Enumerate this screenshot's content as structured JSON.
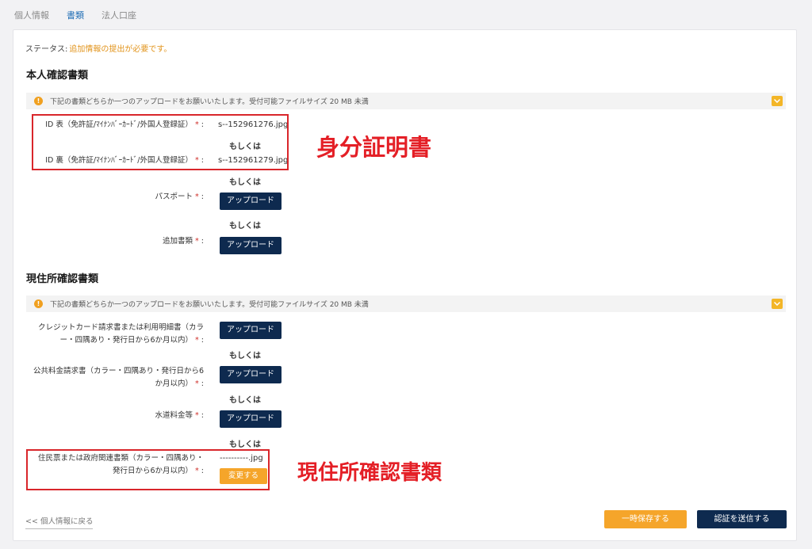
{
  "tabs": [
    "個人情報",
    "書類",
    "法人口座"
  ],
  "status": {
    "label": "ステータス:",
    "value": "追加情報の提出が必要です。"
  },
  "identity": {
    "title": "本人確認書類",
    "notice": "下記の書類どちらか一つのアップロードをお願いいたします。受付可能ファイルサイズ 20 MB 未満",
    "id_front": {
      "label": "ID 表（免許証/ﾏｲﾅﾝﾊﾞｰｶｰﾄﾞ/外国人登録証）",
      "file": "s--152961276.jpg"
    },
    "id_back": {
      "label": "ID 裏（免許証/ﾏｲﾅﾝﾊﾞｰｶｰﾄﾞ/外国人登録証）",
      "file": "s--152961279.jpg"
    },
    "passport": {
      "label": "パスポート"
    },
    "additional": {
      "label": "追加書類"
    }
  },
  "address": {
    "title": "現住所確認書類",
    "notice": "下記の書類どちらか一つのアップロードをお願いいたします。受付可能ファイルサイズ 20 MB 未満",
    "credit": {
      "line1": "クレジットカード請求書または利用明細書（カラ",
      "line2": "ー・四隅あり・発行日から6か月以内）"
    },
    "utility": {
      "line1": "公共料金請求書（カラー・四隅あり・発行日から6",
      "line2": "か月以内）"
    },
    "water": {
      "label": "水道料金等"
    },
    "resident": {
      "line1": "住民票または政府関連書類（カラー・四隅あり・",
      "line2": "発行日から6か月以内）",
      "file": "----------.jpg"
    }
  },
  "common": {
    "required": "*",
    "colon": ":",
    "or": "もしくは",
    "upload": "アップロード",
    "change": "変更する"
  },
  "annotations": {
    "identity": "身分証明書",
    "address": "現住所確認書類"
  },
  "footer": {
    "back": "<< 個人情報に戻る",
    "save": "一時保存する",
    "submit": "認証を送信する"
  },
  "colors": {
    "navy": "#0e2a4f",
    "orange": "#f5a52a",
    "highlight": "#d9262b",
    "annotation": "#e41f26",
    "tab_active": "#1f6db5"
  }
}
